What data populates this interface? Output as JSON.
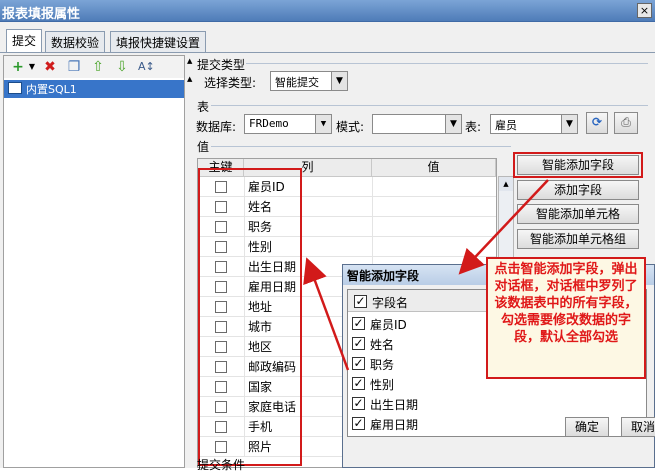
{
  "window": {
    "title": "报表填报属性",
    "close": "×"
  },
  "tabs": [
    {
      "label": "提交"
    },
    {
      "label": "数据校验"
    },
    {
      "label": "填报快捷键设置"
    }
  ],
  "left": {
    "tree_item": "内置SQL1"
  },
  "submit_type": {
    "section": "提交类型",
    "label": "选择类型:",
    "value": "智能提交"
  },
  "table": {
    "section": "表",
    "db_label": "数据库:",
    "db_value": "FRDemo",
    "schema_label": "模式:",
    "schema_value": "",
    "table_label": "表:",
    "table_value": "雇员"
  },
  "values": {
    "section": "值",
    "col_key": "主键",
    "col_column": "列",
    "col_value": "值"
  },
  "rows": [
    "雇员ID",
    "姓名",
    "职务",
    "性别",
    "出生日期",
    "雇用日期",
    "地址",
    "城市",
    "地区",
    "邮政编码",
    "国家",
    "家庭电话",
    "手机",
    "照片"
  ],
  "buttons": {
    "smart_add_field": "智能添加字段",
    "add_field": "添加字段",
    "smart_add_cell": "智能添加单元格",
    "smart_add_cell_group": "智能添加单元格组"
  },
  "bottom_section": "提交条件",
  "dialog": {
    "title": "智能添加字段",
    "header": "字段名",
    "fields": [
      "雇员ID",
      "姓名",
      "职务",
      "性别",
      "出生日期",
      "雇用日期"
    ],
    "ok": "确定",
    "cancel": "取消"
  },
  "callout": "点击智能添加字段，弹出对话框，对话框中罗列了该数据表中的所有字段，勾选需要修改数据的字段，默认全部勾选",
  "colors": {
    "annotation": "#d21a1a",
    "titlebar": "#4f7cb8",
    "selection": "#3875c9"
  }
}
